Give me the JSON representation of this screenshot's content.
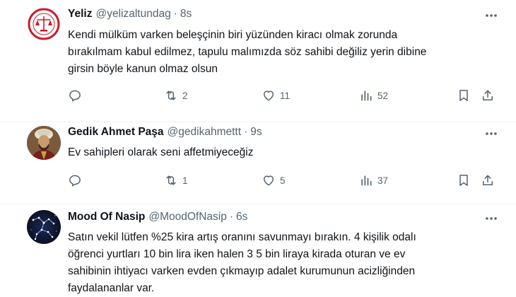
{
  "tweets": [
    {
      "name": "Yeliz",
      "handle": "@yelizaltundag",
      "time": "8s",
      "avatar_icon": "justice-emblem-avatar",
      "text": "Kendi mülküm varken beleşçinin biri yüzünden kiracı olmak zorunda\nbırakılmam kabul edilmez, tapulu malımızda söz sahibi değiliz yerin dibine\ngirsin böyle kanun olmaz olsun",
      "replies": "",
      "retweets": "2",
      "likes": "11",
      "views": "52"
    },
    {
      "name": "Gedik Ahmet Paşa",
      "handle": "@gedikahmettt",
      "time": "9s",
      "avatar_icon": "portrait-avatar",
      "text": "Ev sahipleri olarak seni affetmiyeceğiz",
      "replies": "",
      "retweets": "1",
      "likes": "5",
      "views": "37"
    },
    {
      "name": "Mood Of Nasip",
      "handle": "@MoodOfNasip",
      "time": "6s",
      "avatar_icon": "constellation-avatar",
      "text": "Satın vekil lütfen %25 kira artış oranını savunmayı bırakın. 4 kişilik odalı\nöğrenci yurtları 10 bin lira iken halen 3  5 bin liraya kirada oturan ve ev\nsahibinin ihtiyacı varken evden çıkmayıp adalet kurumunun acizliğinden\nfaydalananlar var."
    }
  ],
  "separator": "·",
  "colors": {
    "text": "#0f1419",
    "secondary": "#536471",
    "divider": "#eff3f4"
  }
}
